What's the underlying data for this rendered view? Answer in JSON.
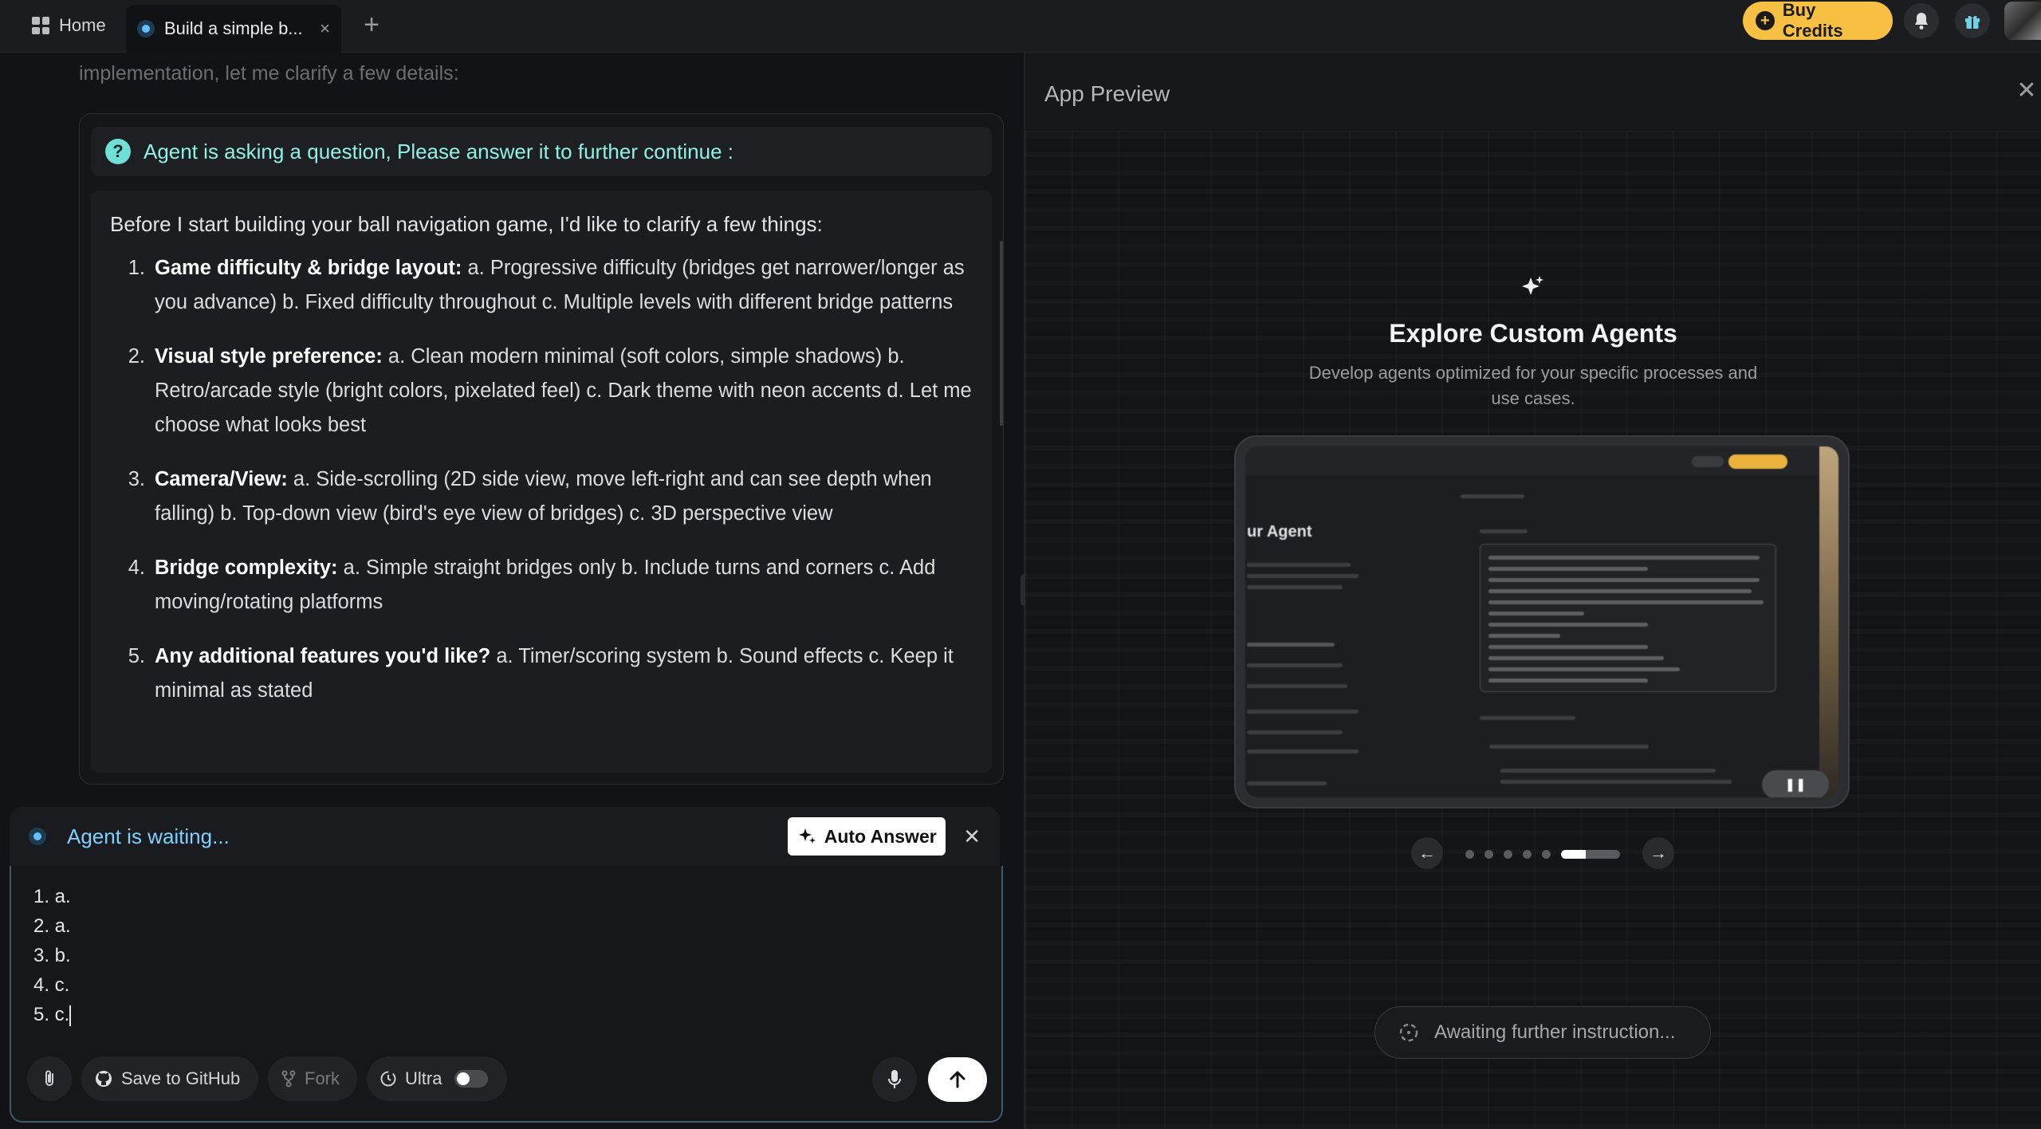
{
  "tabs": {
    "home_label": "Home",
    "active_title": "Build a simple b...",
    "close_glyph": "×",
    "add_glyph": "+"
  },
  "header_actions": {
    "buy_credits_label": "Buy Credits",
    "icons": [
      "notification-bell-icon",
      "gift-icon",
      "user-avatar"
    ]
  },
  "chat": {
    "faded_text": "implementation, let me clarify a few details:",
    "question_banner": "Agent is asking a question, Please answer it to further continue :",
    "question_intro": "Before I start building your ball navigation game, I'd like to clarify a few things:",
    "questions": [
      {
        "num": "1.",
        "title": "Game difficulty & bridge layout:",
        "text": " a. Progressive difficulty (bridges get narrower/longer as you advance) b. Fixed difficulty throughout c. Multiple levels with different bridge patterns"
      },
      {
        "num": "2.",
        "title": "Visual style preference:",
        "text": " a. Clean modern minimal (soft colors, simple shadows) b. Retro/arcade style (bright colors, pixelated feel) c. Dark theme with neon accents d. Let me choose what looks best"
      },
      {
        "num": "3.",
        "title": "Camera/View:",
        "text": " a. Side-scrolling (2D side view, move left-right and can see depth when falling) b. Top-down view (bird's eye view of bridges) c. 3D perspective view"
      },
      {
        "num": "4.",
        "title": "Bridge complexity:",
        "text": " a. Simple straight bridges only b. Include turns and corners c. Add moving/rotating platforms"
      },
      {
        "num": "5.",
        "title": "Any additional features you'd like?",
        "text": " a. Timer/scoring system b. Sound effects c. Keep it minimal as stated"
      }
    ]
  },
  "waiting": {
    "status": "Agent is waiting...",
    "auto_answer_label": "Auto Answer",
    "close_glyph": "✕"
  },
  "composer": {
    "answer_lines": [
      "1. a.",
      "2. a.",
      "3. b.",
      "4. c.",
      "5. c."
    ],
    "github_label": "Save to GitHub",
    "fork_label": "Fork",
    "ultra_label": "Ultra",
    "ultra_enabled": false
  },
  "preview": {
    "title": "App Preview",
    "close_glyph": "✕",
    "explore_title": "Explore Custom Agents",
    "explore_subtitle": "Develop agents optimized for your specific processes and use cases.",
    "screen_heading": "ur Agent",
    "carousel_count": 6,
    "carousel_active_index": 5,
    "awaiting_text": "Awaiting further instruction..."
  },
  "colors": {
    "accent_cyan": "#8ff0e6",
    "accent_blue": "#7fd0ff",
    "credits_yellow": "#f7c042"
  }
}
